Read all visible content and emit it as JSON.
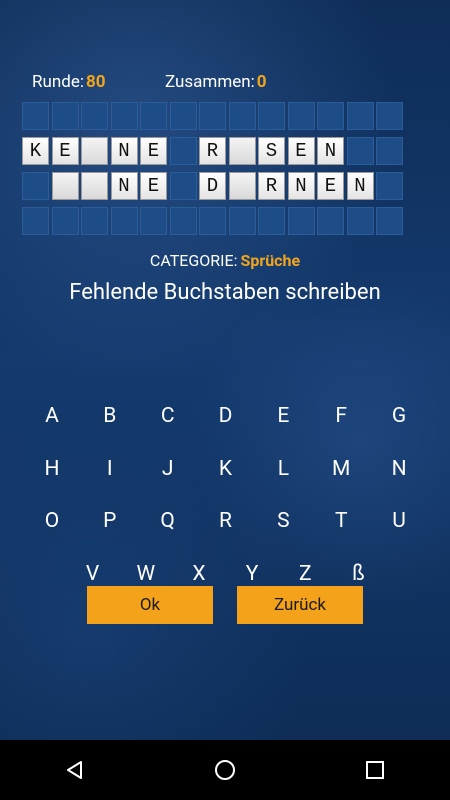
{
  "stats": {
    "round_label": "Runde:",
    "round_value": "80",
    "total_label": "Zusammen:",
    "total_value": "0"
  },
  "board": {
    "rows": [
      [
        "",
        "",
        "",
        "",
        "",
        "",
        "",
        "",
        "",
        "",
        "",
        "",
        ""
      ],
      [
        "K",
        "E",
        "_",
        "N",
        "E",
        "",
        "R",
        "_",
        "S",
        "E",
        "N",
        "",
        ""
      ],
      [
        "",
        "_",
        "_",
        "N",
        "E",
        "",
        "D",
        "_",
        "R",
        "N",
        "E",
        "N",
        ""
      ],
      [
        "",
        "",
        "",
        "",
        "",
        "",
        "",
        "",
        "",
        "",
        "",
        "",
        ""
      ]
    ]
  },
  "category": {
    "label": "CATEGORIE:",
    "value": "Sprüche"
  },
  "instruction": "Fehlende Buchstaben schreiben",
  "keyboard": {
    "rows": [
      [
        "A",
        "B",
        "C",
        "D",
        "E",
        "F",
        "G"
      ],
      [
        "H",
        "I",
        "J",
        "K",
        "L",
        "M",
        "N"
      ],
      [
        "O",
        "P",
        "Q",
        "R",
        "S",
        "T",
        "U"
      ],
      [
        "V",
        "W",
        "X",
        "Y",
        "Z",
        "ß"
      ]
    ]
  },
  "buttons": {
    "ok": "Ok",
    "back": "Zurück"
  },
  "navbar": {
    "icons": [
      "back-icon",
      "home-icon",
      "recents-icon"
    ]
  },
  "colors": {
    "accent": "#f4a21a",
    "background": "#143a6e"
  }
}
